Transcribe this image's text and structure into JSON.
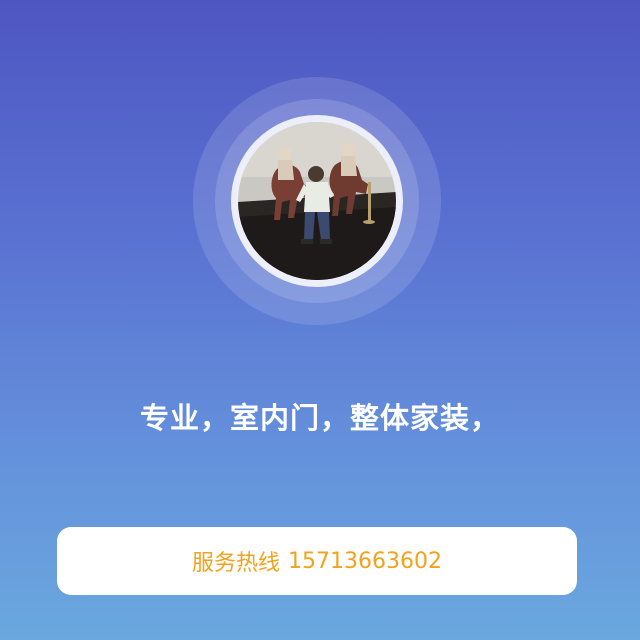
{
  "profile": {
    "headline": "专业，室内门，整体家装，",
    "hotline_label": "服务热线",
    "hotline_number": "15713663602"
  },
  "colors": {
    "gradient_top": "#4e56c2",
    "gradient_bottom": "#6aa8de",
    "headline_text": "#ffffff",
    "hotline_text": "#f2a21b",
    "hotline_bg": "#ffffff"
  },
  "icons": {
    "avatar": "profile-photo"
  }
}
